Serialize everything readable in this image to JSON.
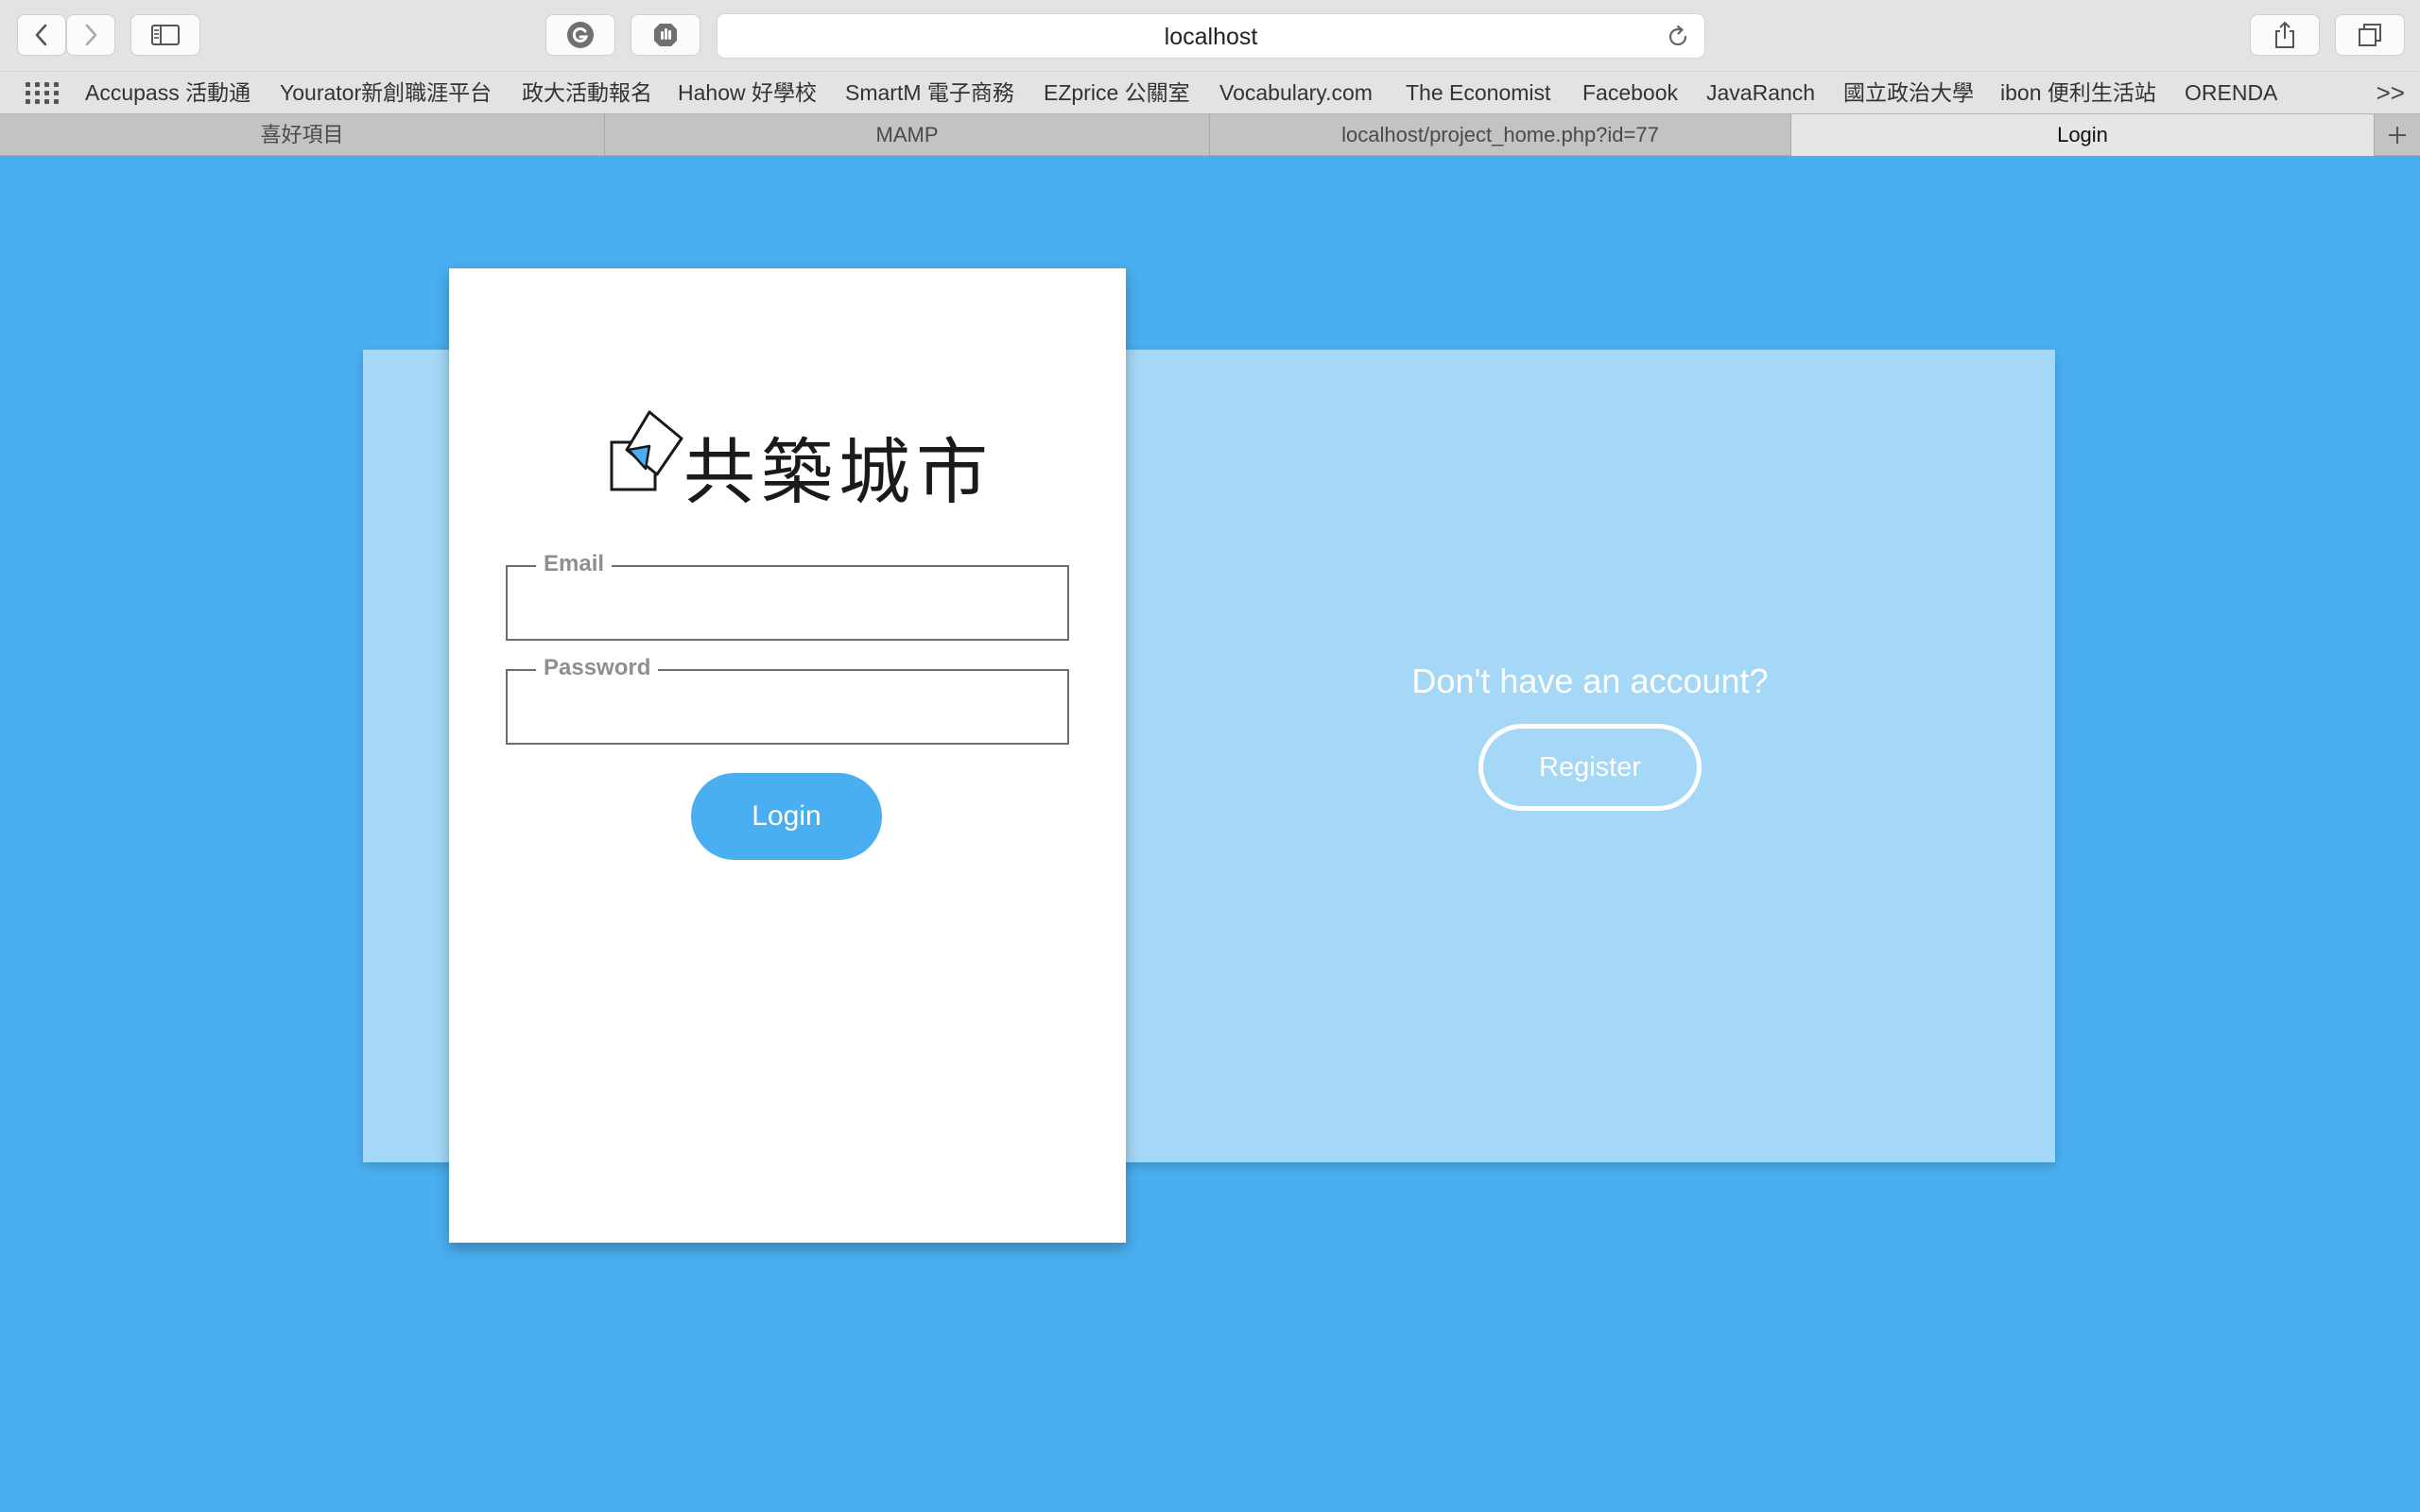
{
  "browser": {
    "url": "localhost",
    "bookmarks": [
      "Accupass 活動通",
      "Yourator新創職涯平台",
      "政大活動報名",
      "Hahow 好學校",
      "SmartM 電子商務",
      "EZprice 公關室",
      "Vocabulary.com",
      "The Economist",
      "Facebook",
      "JavaRanch",
      "國立政治大學",
      "ibon 便利生活站",
      "ORENDA"
    ],
    "more_label": ">>",
    "tabs": [
      {
        "label": "喜好項目",
        "active": false
      },
      {
        "label": "MAMP",
        "active": false
      },
      {
        "label": "localhost/project_home.php?id=77",
        "active": false
      },
      {
        "label": "Login",
        "active": true
      }
    ]
  },
  "login": {
    "logo_text": "共築城市",
    "email_label": "Email",
    "email_value": "",
    "password_label": "Password",
    "password_value": "",
    "button_label": "Login"
  },
  "register": {
    "prompt": "Don't have an account?",
    "button_label": "Register"
  },
  "colors": {
    "page_background": "#4aaff0",
    "panel_background": "#a4d8f6",
    "card_background": "#ffffff",
    "accent": "#4aaff0"
  },
  "icons": [
    "back-icon",
    "forward-icon",
    "sidebar-icon",
    "grammarly-icon",
    "privacy-icon",
    "reload-icon",
    "share-icon",
    "tabs-overview-icon",
    "apps-grid-icon",
    "new-tab-icon",
    "logo-icon"
  ]
}
